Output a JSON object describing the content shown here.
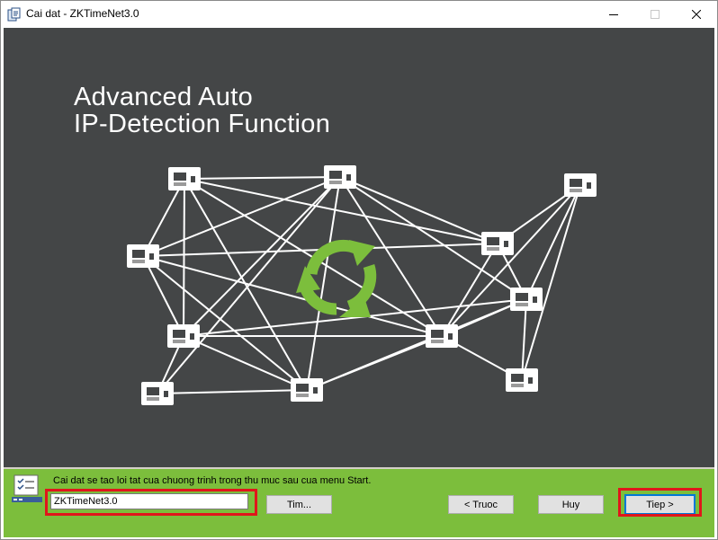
{
  "window": {
    "title": "Cai dat - ZKTimeNet3.0",
    "controls": [
      "minimize-icon",
      "maximize-icon",
      "close-icon"
    ]
  },
  "banner": {
    "headline_line1": "Advanced Auto",
    "headline_line2": "IP-Detection Function",
    "background": "#444647",
    "accent": "#7cbe3c"
  },
  "footer": {
    "info_text": "Cai dat se tao loi tat cua chuong trinh trong thu muc sau cua menu Start.",
    "folder_value": "ZKTimeNet3.0",
    "browse_label": "Tim...",
    "back_label": "< Truoc",
    "cancel_label": "Huy",
    "next_label": "Tiep >",
    "background": "#7cbe3c",
    "highlight": "#e0161b"
  }
}
